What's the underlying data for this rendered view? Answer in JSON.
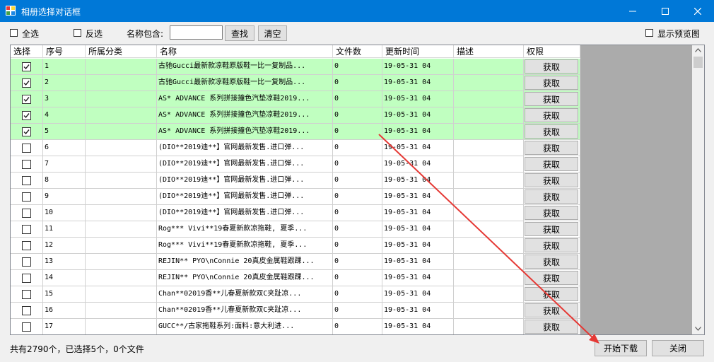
{
  "window": {
    "title": "相册选择对话框",
    "accent": "#0078d7",
    "controls": [
      "minimize-icon",
      "maximize-icon",
      "close-icon"
    ]
  },
  "toolbar": {
    "select_all": "全选",
    "invert": "反选",
    "name_contains_label": "名称包含:",
    "name_filter_value": "",
    "search_button": "查找",
    "clear_button": "清空",
    "show_preview": "显示预览图"
  },
  "table": {
    "columns": [
      "选择",
      "序号",
      "所属分类",
      "名称",
      "文件数",
      "更新时间",
      "描述",
      "权限"
    ],
    "rows": [
      {
        "checked": true,
        "index": "1",
        "category": "",
        "name": "古驰Gucci最新款凉鞋原版鞋一比一复制品...",
        "files": "0",
        "updated": "19-05-31 04",
        "desc": "",
        "action": "获取"
      },
      {
        "checked": true,
        "index": "2",
        "category": "",
        "name": "古驰Gucci最新款凉鞋原版鞋一比一复制品...",
        "files": "0",
        "updated": "19-05-31 04",
        "desc": "",
        "action": "获取"
      },
      {
        "checked": true,
        "index": "3",
        "category": "",
        "name": "AS*  ADVANCE 系列拼接撞色汽垫凉鞋2019...",
        "files": "0",
        "updated": "19-05-31 04",
        "desc": "",
        "action": "获取"
      },
      {
        "checked": true,
        "index": "4",
        "category": "",
        "name": "AS*  ADVANCE 系列拼接撞色汽垫凉鞋2019...",
        "files": "0",
        "updated": "19-05-31 04",
        "desc": "",
        "action": "获取"
      },
      {
        "checked": true,
        "index": "5",
        "category": "",
        "name": "AS*  ADVANCE 系列拼接撞色汽垫凉鞋2019...",
        "files": "0",
        "updated": "19-05-31 04",
        "desc": "",
        "action": "获取"
      },
      {
        "checked": false,
        "index": "6",
        "category": "",
        "name": "(DIO**2019迪**】官网最新发售.进口弹...",
        "files": "0",
        "updated": "19-05-31 04",
        "desc": "",
        "action": "获取"
      },
      {
        "checked": false,
        "index": "7",
        "category": "",
        "name": "(DIO**2019迪**】官网最新发售.进口弹...",
        "files": "0",
        "updated": "19-05-31 04",
        "desc": "",
        "action": "获取"
      },
      {
        "checked": false,
        "index": "8",
        "category": "",
        "name": "(DIO**2019迪**】官网最新发售.进口弹...",
        "files": "0",
        "updated": "19-05-31 04",
        "desc": "",
        "action": "获取"
      },
      {
        "checked": false,
        "index": "9",
        "category": "",
        "name": "(DIO**2019迪**】官网最新发售.进口弹...",
        "files": "0",
        "updated": "19-05-31 04",
        "desc": "",
        "action": "获取"
      },
      {
        "checked": false,
        "index": "10",
        "category": "",
        "name": "(DIO**2019迪**】官网最新发售.进口弹...",
        "files": "0",
        "updated": "19-05-31 04",
        "desc": "",
        "action": "获取"
      },
      {
        "checked": false,
        "index": "11",
        "category": "",
        "name": "Rog***  Vivi**19春夏新款凉拖鞋, 夏季...",
        "files": "0",
        "updated": "19-05-31 04",
        "desc": "",
        "action": "获取"
      },
      {
        "checked": false,
        "index": "12",
        "category": "",
        "name": "Rog***  Vivi**19春夏新款凉拖鞋, 夏季...",
        "files": "0",
        "updated": "19-05-31 04",
        "desc": "",
        "action": "获取"
      },
      {
        "checked": false,
        "index": "13",
        "category": "",
        "name": "REJIN** PYO\\nConnie 20真皮金属鞋跟踝...",
        "files": "0",
        "updated": "19-05-31 04",
        "desc": "",
        "action": "获取"
      },
      {
        "checked": false,
        "index": "14",
        "category": "",
        "name": "REJIN** PYO\\nConnie 20真皮金属鞋跟踝...",
        "files": "0",
        "updated": "19-05-31 04",
        "desc": "",
        "action": "获取"
      },
      {
        "checked": false,
        "index": "15",
        "category": "",
        "name": "Chan**02019香**儿春夏新款双C夹趾凉...",
        "files": "0",
        "updated": "19-05-31 04",
        "desc": "",
        "action": "获取"
      },
      {
        "checked": false,
        "index": "16",
        "category": "",
        "name": "Chan**02019香**儿春夏新款双C夹趾凉...",
        "files": "0",
        "updated": "19-05-31 04",
        "desc": "",
        "action": "获取"
      },
      {
        "checked": false,
        "index": "17",
        "category": "",
        "name": "GUCC**/古家拖鞋系列:面料:意大利进...",
        "files": "0",
        "updated": "19-05-31 04",
        "desc": "",
        "action": "获取"
      }
    ],
    "selected_row_color": "#c0ffc0"
  },
  "status": {
    "text": "共有2790个，已选择5个，0个文件"
  },
  "footer": {
    "start_download": "开始下载",
    "close": "关闭"
  },
  "annotation": {
    "arrow_color": "#e53935"
  }
}
